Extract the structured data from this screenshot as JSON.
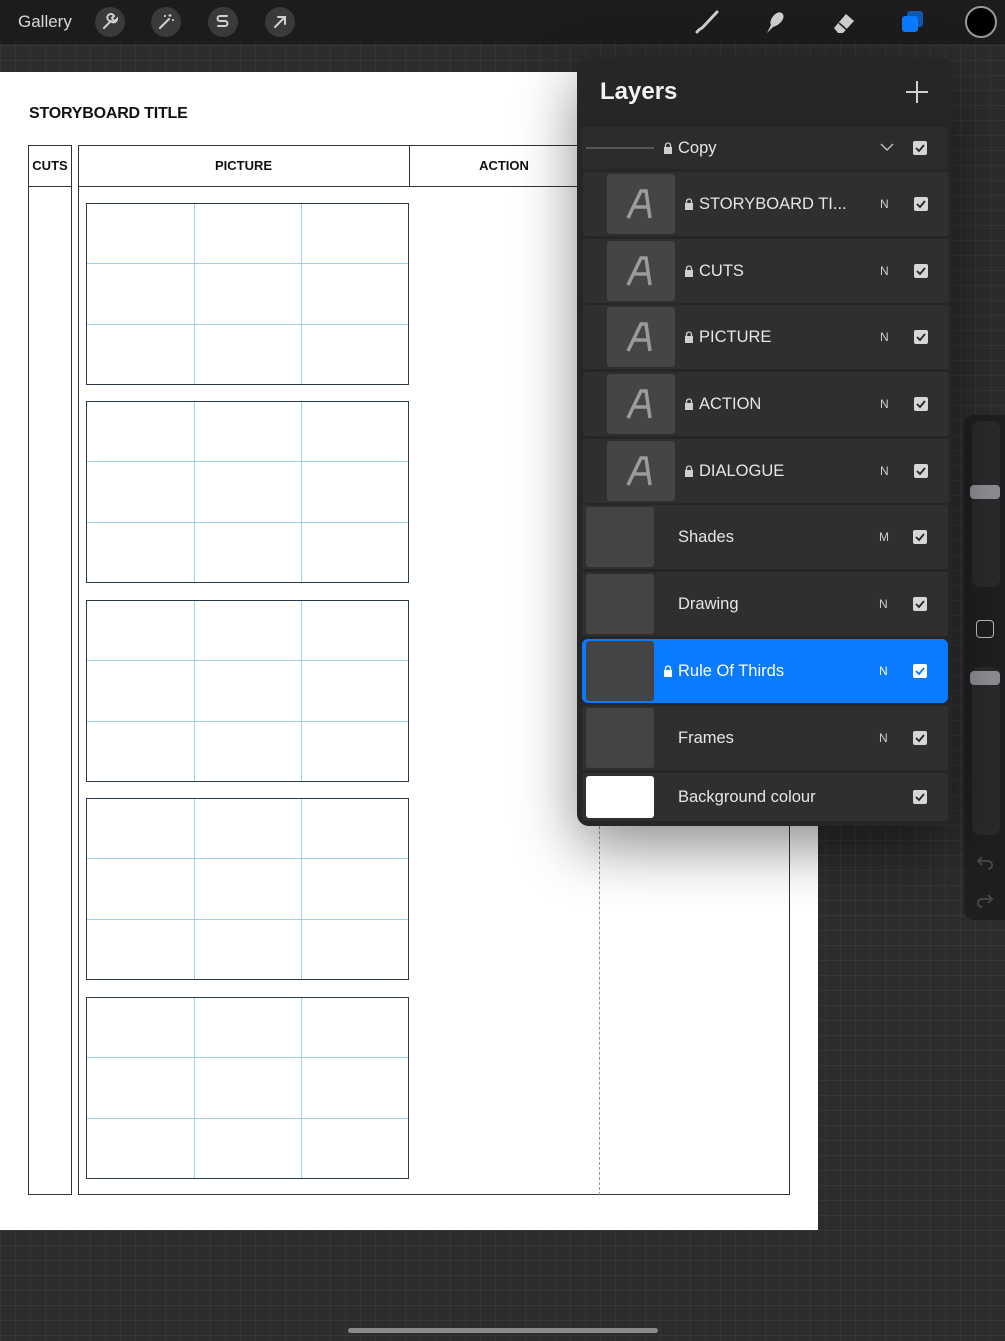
{
  "toolbar": {
    "gallery_label": "Gallery",
    "left_tools": [
      "wrench-icon",
      "magic-wand-icon",
      "selection-s-icon",
      "transform-arrow-icon"
    ],
    "right_tools": [
      "brush-icon",
      "smudge-icon",
      "eraser-icon",
      "layers-icon"
    ],
    "active_tool": "layers-icon",
    "accent_color": "#0a7aff",
    "current_color": "#000000"
  },
  "canvas": {
    "title": "STORYBOARD TITLE",
    "headers": {
      "cuts": "CUTS",
      "picture": "PICTURE",
      "action": "ACTION"
    },
    "frame_count": 5
  },
  "layers": {
    "title": "Layers",
    "group": {
      "name": "Copy",
      "locked": true,
      "expanded": true,
      "visible": true
    },
    "items": [
      {
        "name": "STORYBOARD TI...",
        "type": "text",
        "locked": true,
        "blend": "N",
        "visible": true,
        "child": true
      },
      {
        "name": "CUTS",
        "type": "text",
        "locked": true,
        "blend": "N",
        "visible": true,
        "child": true
      },
      {
        "name": "PICTURE",
        "type": "text",
        "locked": true,
        "blend": "N",
        "visible": true,
        "child": true
      },
      {
        "name": "ACTION",
        "type": "text",
        "locked": true,
        "blend": "N",
        "visible": true,
        "child": true
      },
      {
        "name": "DIALOGUE",
        "type": "text",
        "locked": true,
        "blend": "N",
        "visible": true,
        "child": true
      },
      {
        "name": "Shades",
        "type": "raster",
        "locked": false,
        "blend": "M",
        "visible": true
      },
      {
        "name": "Drawing",
        "type": "raster",
        "locked": false,
        "blend": "N",
        "visible": true
      },
      {
        "name": "Rule Of Thirds",
        "type": "raster",
        "locked": true,
        "blend": "N",
        "visible": true,
        "selected": true
      },
      {
        "name": "Frames",
        "type": "raster",
        "locked": false,
        "blend": "N",
        "visible": true
      },
      {
        "name": "Background colour",
        "type": "background",
        "locked": false,
        "blend": "",
        "visible": true
      }
    ]
  }
}
